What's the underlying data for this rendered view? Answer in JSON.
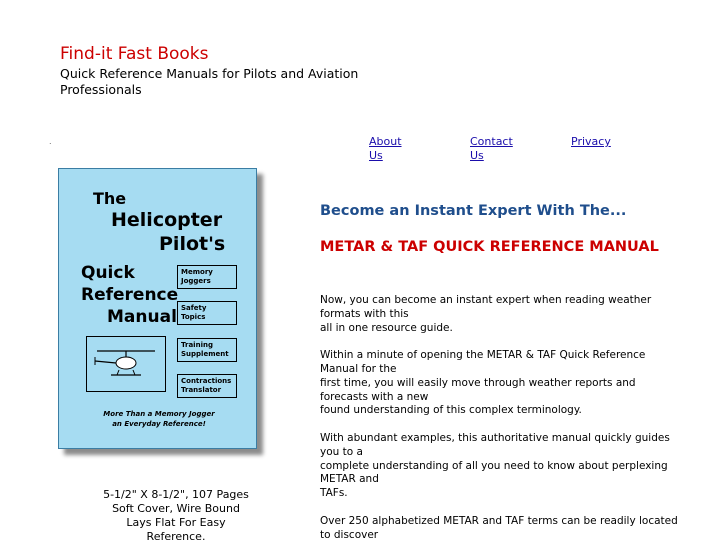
{
  "site": {
    "title": "Find-it Fast Books",
    "tagline": "Quick Reference Manuals for Pilots and Aviation Professionals"
  },
  "nav": {
    "items": [
      {
        "label": "About Us"
      },
      {
        "label": "Contact Us"
      },
      {
        "label": "Privacy"
      }
    ]
  },
  "book_cover": {
    "line1": "The",
    "line2": "Helicopter",
    "line3": "Pilot's",
    "line4": "Quick",
    "line5": "Reference",
    "line6": "Manual",
    "tags": [
      "Memory Joggers",
      "Safety Topics",
      "Training Supplement",
      "Contractions Translator"
    ],
    "bottom_line1": "More Than a Memory Jogger",
    "bottom_line2": "an Everyday Reference!"
  },
  "book_details": {
    "line1": "5-1/2\" X 8-1/2\", 107 Pages",
    "line2": "Soft Cover, Wire Bound",
    "line3": "Lays Flat For Easy",
    "line4": "Reference."
  },
  "main": {
    "headline": "Become an Instant Expert With The...",
    "product_title": "METAR & TAF QUICK REFERENCE MANUAL",
    "p1": [
      "Now, you can become an instant expert when reading weather formats with this",
      "all in one resource guide."
    ],
    "p2": [
      "Within a minute of opening the METAR & TAF Quick Reference Manual for the",
      "first time, you will easily move through weather reports and forecasts with a new",
      "found understanding of this complex terminology."
    ],
    "p3": [
      "With abundant examples, this authoritative manual quickly guides you to a",
      "complete understanding of all you need to know about perplexing METAR and",
      "TAFs."
    ],
    "p4": [
      "Over 250 alphabetized METAR and TAF terms can be readily located to discover"
    ]
  },
  "colors": {
    "title_red": "#cc0000",
    "headline_blue": "#1f4e8c",
    "link_blue": "#1a0dab",
    "cover_blue": "#a6dcf2"
  }
}
